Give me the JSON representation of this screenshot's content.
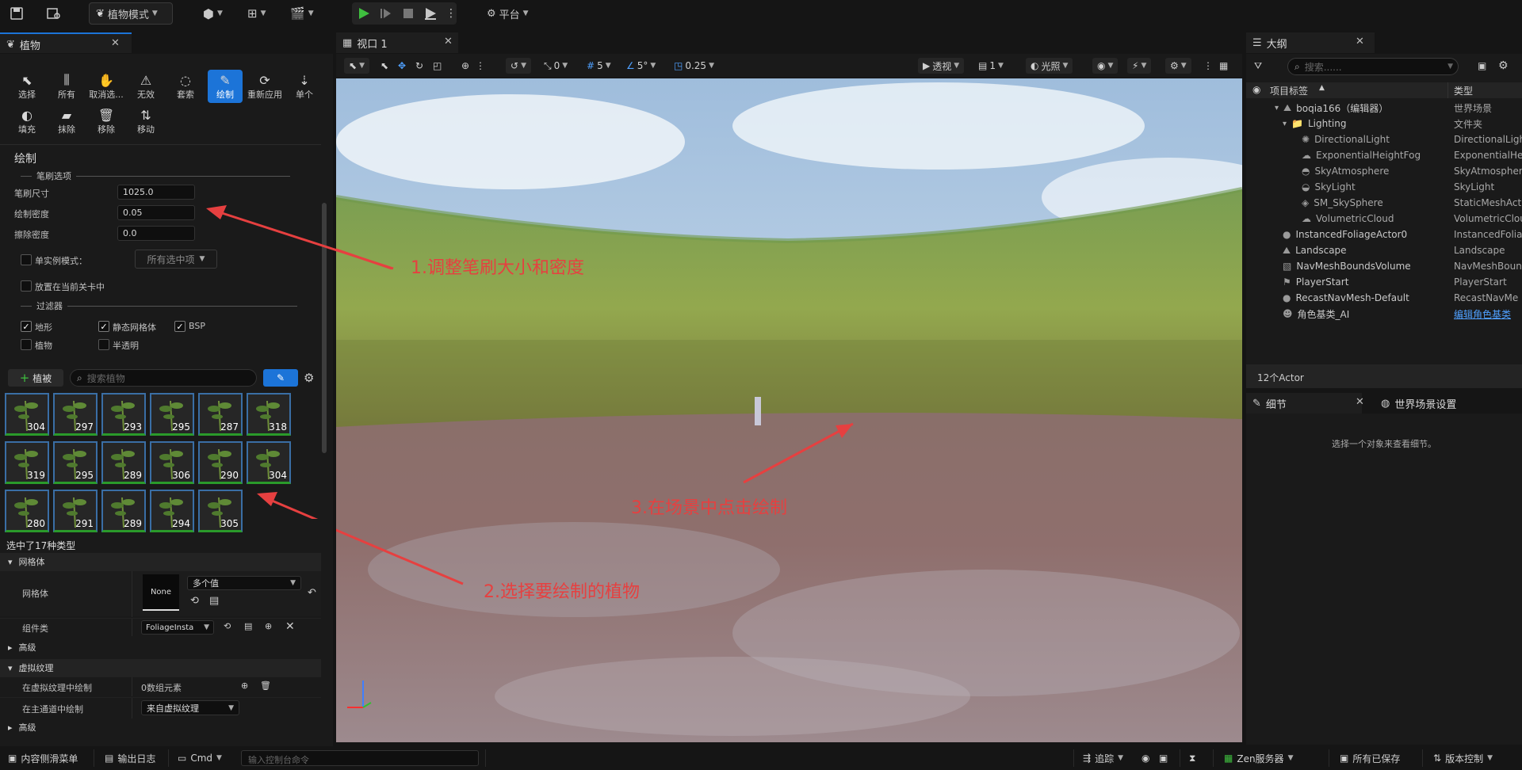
{
  "toolbar": {
    "mode_label": "植物模式",
    "platform_label": "平台"
  },
  "foliage_panel": {
    "tab_title": "植物",
    "tools_row1": [
      "选择",
      "所有",
      "取消选...",
      "无效",
      "套索",
      "绘制",
      "重新应用",
      "单个"
    ],
    "tools_row2": [
      "填充",
      "抹除",
      "移除",
      "移动"
    ],
    "active_tool": "绘制",
    "section_title": "绘制",
    "brush_options_label": "笔刷选项",
    "brush_size_label": "笔刷尺寸",
    "brush_size_value": "1025.0",
    "paint_density_label": "绘制密度",
    "paint_density_value": "0.05",
    "erase_density_label": "擦除密度",
    "erase_density_value": "0.0",
    "single_instance_label": "单实例模式：",
    "single_instance_option": "所有选中项",
    "place_current_level_label": "放置在当前关卡中",
    "filters_label": "过滤器",
    "filters": [
      {
        "label": "地形",
        "checked": true
      },
      {
        "label": "静态网格体",
        "checked": true
      },
      {
        "label": "BSP",
        "checked": true
      },
      {
        "label": "植物",
        "checked": false
      },
      {
        "label": "半透明",
        "checked": false
      }
    ],
    "add_foliage_label": "植被",
    "search_placeholder": "搜索植物",
    "foliage_counts": [
      "304",
      "297",
      "293",
      "295",
      "287",
      "318",
      "319",
      "295",
      "289",
      "306",
      "290",
      "304",
      "280",
      "291",
      "289",
      "294",
      "305"
    ],
    "selected_types_text": "选中了17种类型",
    "mesh_category": "网格体",
    "mesh_label": "网格体",
    "mesh_thumb_text": "None",
    "mesh_value": "多个值",
    "component_label": "组件类",
    "component_value": "FoliageInsta",
    "advanced_label": "高级",
    "vt_category": "虚拟纹理",
    "vt_draw_label": "在虚拟纹理中绘制",
    "vt_draw_value": "0数组元素",
    "main_pass_label": "在主通道中绘制",
    "main_pass_value": "来自虚拟纹理",
    "advanced2_label": "高级"
  },
  "viewport": {
    "tab_title": "视口 1",
    "rotation_snap": "0",
    "grid_snap": "5",
    "angle_snap": "5°",
    "scale_snap": "0.25",
    "perspective_label": "透视",
    "camera_speed": "1",
    "lighting_label": "光照",
    "annotations": [
      "1.调整笔刷大小和密度",
      "2.选择要绘制的植物",
      "3.在场景中点击绘制"
    ]
  },
  "outliner": {
    "tab_title": "大纲",
    "search_placeholder": "搜索......",
    "col_label": "项目标签",
    "col_type": "类型",
    "items": [
      {
        "name": "boqia166（编辑器）",
        "type": "世界场景",
        "indent": 0,
        "icon": "level-icon"
      },
      {
        "name": "Lighting",
        "type": "文件夹",
        "indent": 1,
        "icon": "folder-icon"
      },
      {
        "name": "DirectionalLight",
        "type": "DirectionalLight",
        "indent": 2,
        "icon": "light-icon"
      },
      {
        "name": "ExponentialHeightFog",
        "type": "ExponentialHe",
        "indent": 2,
        "icon": "fog-icon"
      },
      {
        "name": "SkyAtmosphere",
        "type": "SkyAtmospher",
        "indent": 2,
        "icon": "sky-icon"
      },
      {
        "name": "SkyLight",
        "type": "SkyLight",
        "indent": 2,
        "icon": "skylight-icon"
      },
      {
        "name": "SM_SkySphere",
        "type": "StaticMeshAct",
        "indent": 2,
        "icon": "mesh-icon"
      },
      {
        "name": "VolumetricCloud",
        "type": "VolumetricClou",
        "indent": 2,
        "icon": "cloud-icon"
      },
      {
        "name": "InstancedFoliageActor0",
        "type": "InstancedFolia",
        "indent": 1,
        "icon": "actor-icon"
      },
      {
        "name": "Landscape",
        "type": "Landscape",
        "indent": 1,
        "icon": "landscape-icon"
      },
      {
        "name": "NavMeshBoundsVolume",
        "type": "NavMeshBoun",
        "indent": 1,
        "icon": "volume-icon"
      },
      {
        "name": "PlayerStart",
        "type": "PlayerStart",
        "indent": 1,
        "icon": "playerstart-icon"
      },
      {
        "name": "RecastNavMesh-Default",
        "type": "RecastNavMe",
        "indent": 1,
        "icon": "actor-icon"
      },
      {
        "name": "角色基类_AI",
        "type": "编辑角色基类",
        "indent": 1,
        "icon": "pawn-icon",
        "type_link": true
      }
    ],
    "actor_count": "12个Actor"
  },
  "details": {
    "tab_title": "细节",
    "world_settings_tab": "世界场景设置",
    "empty_text": "选择一个对象来查看细节。"
  },
  "statusbar": {
    "content_drawer": "内容侧滑菜单",
    "output_log": "输出日志",
    "cmd_label": "Cmd",
    "console_placeholder": "输入控制台命令",
    "trace_label": "追踪",
    "zen_label": "Zen服务器",
    "saved_label": "所有已保存",
    "version_label": "版本控制"
  },
  "colors": {
    "accent_blue": "#1c74d8",
    "annotation_red": "#e64040",
    "play_green": "#3fbf3f"
  }
}
